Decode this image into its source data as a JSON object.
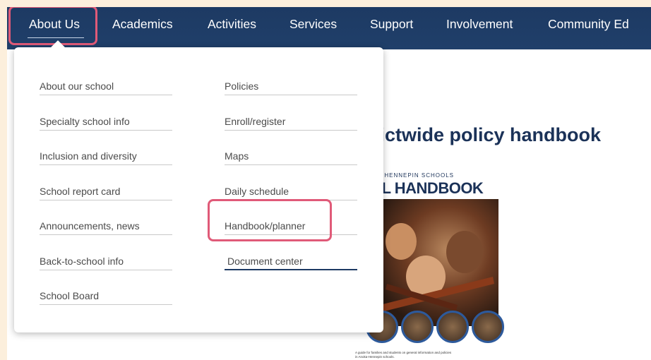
{
  "nav": {
    "items": [
      {
        "label": "About Us",
        "active": true
      },
      {
        "label": "Academics"
      },
      {
        "label": "Activities"
      },
      {
        "label": "Services"
      },
      {
        "label": "Support"
      },
      {
        "label": "Involvement"
      },
      {
        "label": "Community Ed"
      }
    ]
  },
  "dropdown": {
    "left_column": [
      "About our school",
      "Specialty school info",
      "Inclusion and diversity",
      "School report card",
      "Announcements, news",
      "Back-to-school info",
      "School Board"
    ],
    "right_column": [
      "Policies",
      "Enroll/register",
      "Maps",
      "Daily schedule",
      "Handbook/planner",
      "Document center"
    ]
  },
  "content": {
    "heading_partial": "rictwide policy handbook",
    "cover": {
      "subtitle_partial": "KA-HENNEPIN SCHOOLS",
      "title_partial": "OL HANDBOOK",
      "footnote": "A guide for families and students on general information and policies in Anoka-Hennepin schools."
    }
  },
  "colors": {
    "nav_bg": "#1d3a63",
    "highlight": "#e05a78",
    "page_bg": "#fcefdc"
  }
}
